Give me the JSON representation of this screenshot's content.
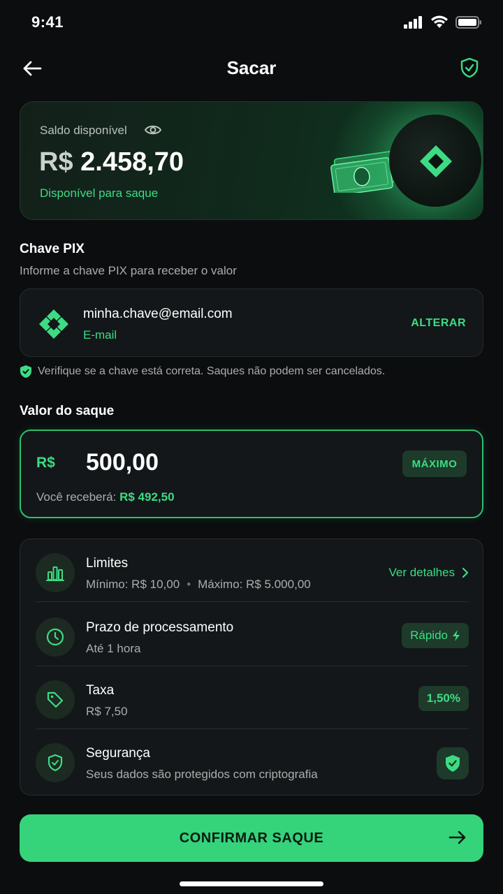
{
  "status": {
    "time": "9:41"
  },
  "header": {
    "title": "Sacar"
  },
  "balance": {
    "label": "Saldo disponível",
    "currency": "R$",
    "amount": "2.458,70",
    "subtitle": "Disponível para saque"
  },
  "pix": {
    "title": "Chave PIX",
    "subtitle": "Informe a chave PIX para receber o valor",
    "key": "minha.chave@email.com",
    "type": "E-mail",
    "change_label": "ALTERAR",
    "warning": "Verifique se a chave está correta. Saques não podem ser cancelados."
  },
  "amount": {
    "title": "Valor do saque",
    "currency": "R$",
    "value": "500,00",
    "max_label": "MÁXIMO",
    "receive_label": "Você receberá:",
    "receive_value": "R$ 492,50"
  },
  "info": {
    "limits": {
      "title": "Limites",
      "min": "Mínimo: R$ 10,00",
      "dot": "•",
      "max": "Máximo: R$ 5.000,00",
      "link": "Ver detalhes"
    },
    "processing": {
      "title": "Prazo de processamento",
      "subtitle": "Até 1 hora",
      "badge": "Rápido"
    },
    "fee": {
      "title": "Taxa",
      "subtitle": "R$ 7,50",
      "badge": "1,50%"
    },
    "security": {
      "title": "Segurança",
      "subtitle": "Seus dados são protegidos com criptografia"
    }
  },
  "confirm": {
    "label": "CONFIRMAR SAQUE"
  },
  "colors": {
    "accent": "#35d47a",
    "background": "#0b0d0f",
    "card": "#131719"
  }
}
